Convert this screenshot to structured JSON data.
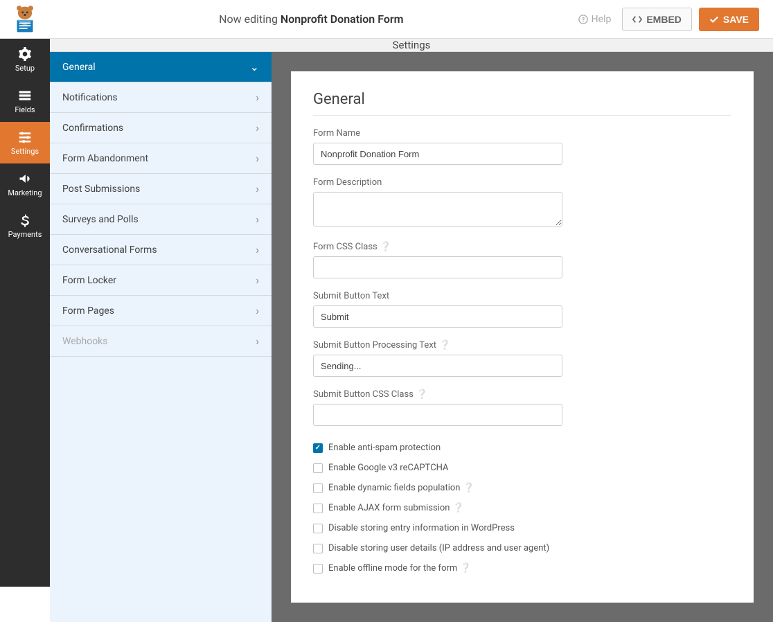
{
  "header": {
    "now_editing": "Now editing",
    "form_name": "Nonprofit Donation Form",
    "help": "Help",
    "embed": "EMBED",
    "save": "SAVE"
  },
  "icon_sidebar": {
    "setup": "Setup",
    "fields": "Fields",
    "settings": "Settings",
    "marketing": "Marketing",
    "payments": "Payments"
  },
  "settings_header": "Settings",
  "settings_menu": {
    "general": "General",
    "notifications": "Notifications",
    "confirmations": "Confirmations",
    "form_abandonment": "Form Abandonment",
    "post_submissions": "Post Submissions",
    "surveys_polls": "Surveys and Polls",
    "conversational_forms": "Conversational Forms",
    "form_locker": "Form Locker",
    "form_pages": "Form Pages",
    "webhooks": "Webhooks"
  },
  "panel": {
    "title": "General",
    "form_name_label": "Form Name",
    "form_name_value": "Nonprofit Donation Form",
    "form_description_label": "Form Description",
    "form_description_value": "",
    "form_css_class_label": "Form CSS Class",
    "form_css_class_value": "",
    "submit_button_text_label": "Submit Button Text",
    "submit_button_text_value": "Submit",
    "submit_button_processing_label": "Submit Button Processing Text",
    "submit_button_processing_value": "Sending...",
    "submit_button_css_class_label": "Submit Button CSS Class",
    "submit_button_css_class_value": "",
    "checkboxes": {
      "antispam": "Enable anti-spam protection",
      "recaptcha": "Enable Google v3 reCAPTCHA",
      "dynamic_fields": "Enable dynamic fields population",
      "ajax": "Enable AJAX form submission",
      "disable_entry": "Disable storing entry information in WordPress",
      "disable_user_details": "Disable storing user details (IP address and user agent)",
      "offline_mode": "Enable offline mode for the form"
    }
  }
}
